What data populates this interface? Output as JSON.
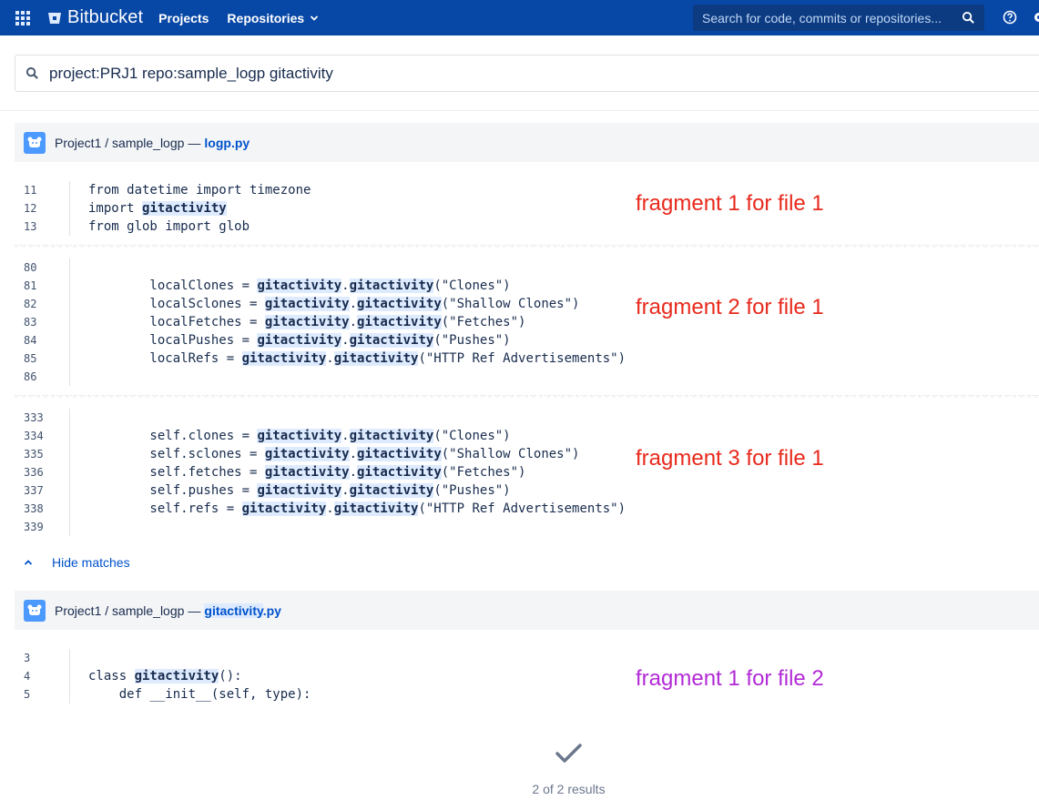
{
  "nav": {
    "brand": "Bitbucket",
    "projects": "Projects",
    "repositories": "Repositories",
    "search_placeholder": "Search for code, commits or repositories...",
    "bg_color": "#0747a6"
  },
  "search": {
    "query": "project:PRJ1 repo:sample_logp gitactivity"
  },
  "files": [
    {
      "path": "Project1 / sample_logp",
      "separator": "—",
      "name": "logp.py",
      "fragments": [
        {
          "annotation": "fragment 1 for file 1",
          "lines": [
            {
              "n": "11",
              "segs": [
                {
                  "t": "from datetime import timezone"
                }
              ]
            },
            {
              "n": "12",
              "segs": [
                {
                  "t": "import "
                },
                {
                  "t": "gitactivity",
                  "hl": true
                }
              ]
            },
            {
              "n": "13",
              "segs": [
                {
                  "t": "from glob import glob"
                }
              ]
            }
          ]
        },
        {
          "annotation": "fragment 2 for file 1",
          "lines": [
            {
              "n": "80",
              "segs": [
                {
                  "t": ""
                }
              ]
            },
            {
              "n": "81",
              "segs": [
                {
                  "t": "        localClones = "
                },
                {
                  "t": "gitactivity",
                  "hl": true
                },
                {
                  "t": "."
                },
                {
                  "t": "gitactivity",
                  "hl": true
                },
                {
                  "t": "(\"Clones\")"
                }
              ]
            },
            {
              "n": "82",
              "segs": [
                {
                  "t": "        localSclones = "
                },
                {
                  "t": "gitactivity",
                  "hl": true
                },
                {
                  "t": "."
                },
                {
                  "t": "gitactivity",
                  "hl": true
                },
                {
                  "t": "(\"Shallow Clones\")"
                }
              ]
            },
            {
              "n": "83",
              "segs": [
                {
                  "t": "        localFetches = "
                },
                {
                  "t": "gitactivity",
                  "hl": true
                },
                {
                  "t": "."
                },
                {
                  "t": "gitactivity",
                  "hl": true
                },
                {
                  "t": "(\"Fetches\")"
                }
              ]
            },
            {
              "n": "84",
              "segs": [
                {
                  "t": "        localPushes = "
                },
                {
                  "t": "gitactivity",
                  "hl": true
                },
                {
                  "t": "."
                },
                {
                  "t": "gitactivity",
                  "hl": true
                },
                {
                  "t": "(\"Pushes\")"
                }
              ]
            },
            {
              "n": "85",
              "segs": [
                {
                  "t": "        localRefs = "
                },
                {
                  "t": "gitactivity",
                  "hl": true
                },
                {
                  "t": "."
                },
                {
                  "t": "gitactivity",
                  "hl": true
                },
                {
                  "t": "(\"HTTP Ref Advertisements\")"
                }
              ]
            },
            {
              "n": "86",
              "segs": [
                {
                  "t": ""
                }
              ]
            }
          ]
        },
        {
          "annotation": "fragment 3 for file 1",
          "lines": [
            {
              "n": "333",
              "segs": [
                {
                  "t": ""
                }
              ]
            },
            {
              "n": "334",
              "segs": [
                {
                  "t": "        self.clones = "
                },
                {
                  "t": "gitactivity",
                  "hl": true
                },
                {
                  "t": "."
                },
                {
                  "t": "gitactivity",
                  "hl": true
                },
                {
                  "t": "(\"Clones\")"
                }
              ]
            },
            {
              "n": "335",
              "segs": [
                {
                  "t": "        self.sclones = "
                },
                {
                  "t": "gitactivity",
                  "hl": true
                },
                {
                  "t": "."
                },
                {
                  "t": "gitactivity",
                  "hl": true
                },
                {
                  "t": "(\"Shallow Clones\")"
                }
              ]
            },
            {
              "n": "336",
              "segs": [
                {
                  "t": "        self.fetches = "
                },
                {
                  "t": "gitactivity",
                  "hl": true
                },
                {
                  "t": "."
                },
                {
                  "t": "gitactivity",
                  "hl": true
                },
                {
                  "t": "(\"Fetches\")"
                }
              ]
            },
            {
              "n": "337",
              "segs": [
                {
                  "t": "        self.pushes = "
                },
                {
                  "t": "gitactivity",
                  "hl": true
                },
                {
                  "t": "."
                },
                {
                  "t": "gitactivity",
                  "hl": true
                },
                {
                  "t": "(\"Pushes\")"
                }
              ]
            },
            {
              "n": "338",
              "segs": [
                {
                  "t": "        self.refs = "
                },
                {
                  "t": "gitactivity",
                  "hl": true
                },
                {
                  "t": "."
                },
                {
                  "t": "gitactivity",
                  "hl": true
                },
                {
                  "t": "(\"HTTP Ref Advertisements\")"
                }
              ]
            },
            {
              "n": "339",
              "segs": [
                {
                  "t": ""
                }
              ]
            }
          ]
        }
      ]
    },
    {
      "path": "Project1 / sample_logp",
      "separator": "—",
      "name_hl": "gitactivity",
      "name_rest": ".py",
      "fragments": [
        {
          "annotation": "fragment 1 for file 2",
          "lines": [
            {
              "n": "3",
              "segs": [
                {
                  "t": ""
                }
              ]
            },
            {
              "n": "4",
              "segs": [
                {
                  "t": "class "
                },
                {
                  "t": "gitactivity",
                  "hl": true
                },
                {
                  "t": "():"
                }
              ]
            },
            {
              "n": "5",
              "segs": [
                {
                  "t": "    def __init__(self, type):"
                }
              ]
            }
          ]
        }
      ]
    }
  ],
  "hide_matches": "Hide matches",
  "results": "2 of 2 results",
  "colors": {
    "annotation_file1": "#e8291c",
    "annotation_file2": "#b22ad6",
    "link": "#0052cc",
    "highlight": "#deebff"
  }
}
